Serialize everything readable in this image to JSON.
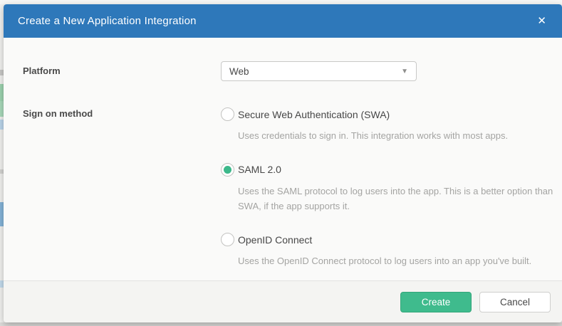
{
  "modal": {
    "title": "Create a New Application Integration",
    "close_icon": "✕",
    "platform": {
      "label": "Platform",
      "value": "Web",
      "arrow_icon": "▼"
    },
    "sign_on_method": {
      "label": "Sign on method",
      "options": [
        {
          "label": "Secure Web Authentication (SWA)",
          "description": "Uses credentials to sign in. This integration works with most apps.",
          "selected": false
        },
        {
          "label": "SAML 2.0",
          "description": "Uses the SAML protocol to log users into the app. This is a better option than SWA, if the app supports it.",
          "selected": true
        },
        {
          "label": "OpenID Connect",
          "description": "Uses the OpenID Connect protocol to log users into an app you've built.",
          "selected": false
        }
      ]
    },
    "footer": {
      "create_label": "Create",
      "cancel_label": "Cancel"
    }
  },
  "colors": {
    "header_blue": "#2e78ba",
    "create_green": "#3fbb8d",
    "selected_radio_green": "#3cb88a"
  }
}
